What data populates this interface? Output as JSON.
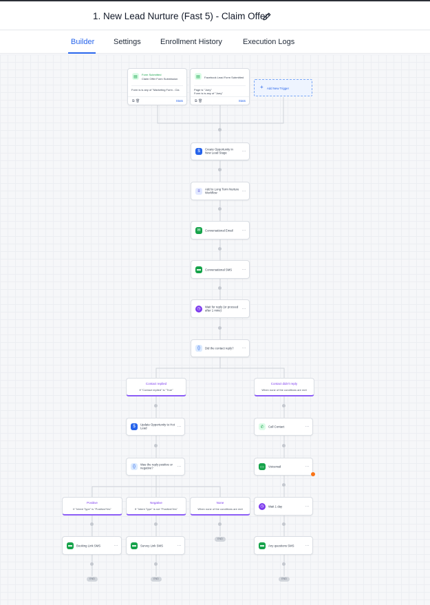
{
  "header": {
    "title": "1. New Lead Nurture (Fast 5) - Claim Offer"
  },
  "tabs": [
    {
      "label": "Builder"
    },
    {
      "label": "Settings"
    },
    {
      "label": "Enrollment History"
    },
    {
      "label": "Execution Logs"
    }
  ],
  "triggers": [
    {
      "type": "Form Submitted",
      "name": "Claim Offer Form Submission",
      "filter": "Form is is any of \"Marketing Form - Cla",
      "stats": "Stats"
    },
    {
      "type": "",
      "name": "Facebook Lead Form Submitted",
      "filter": "Page is \"Joey\"\nForm is is any of \"Joey\"",
      "stats": "Stats"
    }
  ],
  "add_trigger": {
    "label": "Add New Trigger"
  },
  "actions": [
    {
      "label": "Create Opportunity in New Lead Stage"
    },
    {
      "label": "Add to Long Term Nurture Workflow"
    },
    {
      "label": "Conversational Email"
    },
    {
      "label": "Conversational SMS"
    },
    {
      "label": "Wait for reply (or proceed after 1 mins)"
    },
    {
      "label": "Did the contact reply?"
    }
  ],
  "branches": {
    "replied": {
      "title": "Contact replied",
      "cond": "If \"Contact replied\" is \"True\""
    },
    "no_reply": {
      "title": "Contact didn't reply",
      "cond": "When none of the conditions are met"
    },
    "positive": {
      "title": "Positive",
      "cond": "If \"Intent Type\" is \"Positive/Yes\""
    },
    "negative": {
      "title": "Negative",
      "cond": "If \"Intent Type\" is not \"Positive/Yes\""
    },
    "none": {
      "title": "None",
      "cond": "When none of the conditions are met"
    }
  },
  "replied_actions": [
    {
      "label": "Update Opportunity to Hot Lead"
    },
    {
      "label": "Was the reply positive or negative?"
    }
  ],
  "no_reply_actions": [
    {
      "label": "Call Contact"
    },
    {
      "label": "Voicemail"
    },
    {
      "label": "Wait 1 day"
    },
    {
      "label": "Any questions SMS"
    }
  ],
  "leaf_actions": [
    {
      "label": "Booking Link SMS"
    },
    {
      "label": "Survey Link SMS"
    }
  ],
  "end_label": "END",
  "colors": {
    "accent": "#2563eb",
    "branch": "#8b5cf6",
    "sms": "#16a34a",
    "wait": "#7c3aed"
  }
}
